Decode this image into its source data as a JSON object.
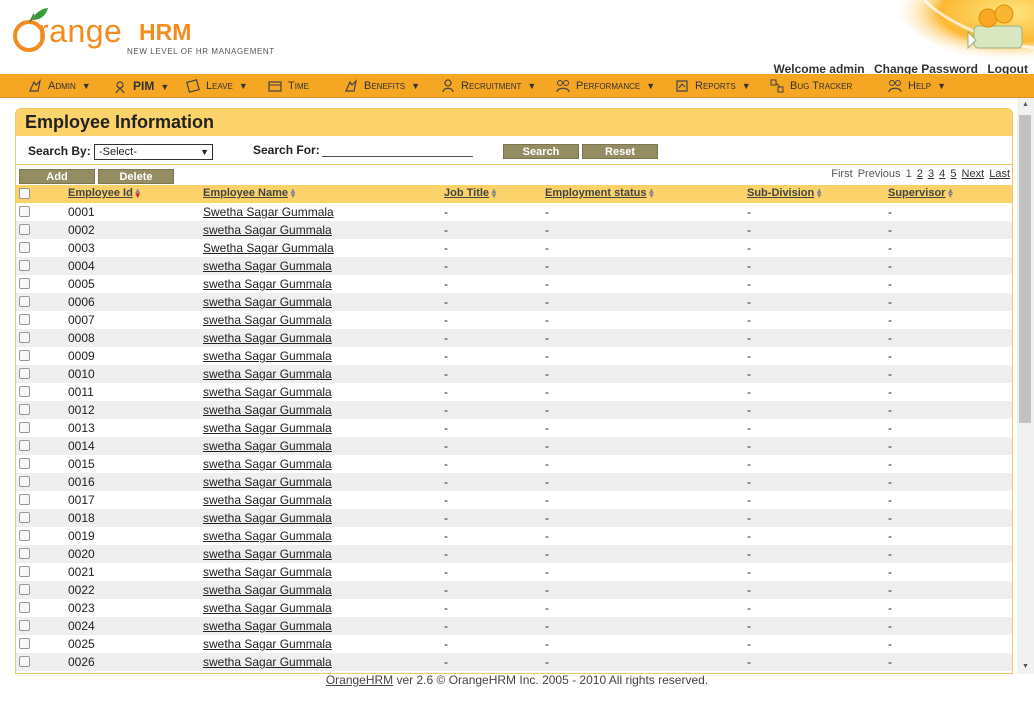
{
  "brand": {
    "logo_main": "range",
    "logo_suffix": "HRM",
    "tagline": "NEW LEVEL OF HR MANAGEMENT",
    "accent": "#f5a623",
    "header_bar": "#fbd36a",
    "button_color": "#948d63"
  },
  "user": {
    "welcome": "Welcome admin",
    "change_password": "Change Password",
    "logout": "Logout"
  },
  "menu": [
    {
      "label": "Admin",
      "icon": "admin-icon"
    },
    {
      "label": "PIM",
      "icon": "pim-icon",
      "active": true
    },
    {
      "label": "Leave",
      "icon": "leave-icon"
    },
    {
      "label": "Time",
      "icon": "time-icon"
    },
    {
      "label": "Benefits",
      "icon": "benefits-icon"
    },
    {
      "label": "Recruitment",
      "icon": "recruitment-icon"
    },
    {
      "label": "Performance",
      "icon": "performance-icon"
    },
    {
      "label": "Reports",
      "icon": "reports-icon"
    },
    {
      "label": "Bug Tracker",
      "icon": "bug-tracker-icon"
    },
    {
      "label": "Help",
      "icon": "help-icon"
    }
  ],
  "page": {
    "title": "Employee Information",
    "search_by_label": "Search By:",
    "search_by_value": "-Select-",
    "search_for_label": "Search For:",
    "search_for_value": "",
    "search_button": "Search",
    "reset_button": "Reset",
    "add_button": "Add",
    "delete_button": "Delete"
  },
  "pager": {
    "first": "First",
    "previous": "Previous",
    "current": "1",
    "pages": [
      "2",
      "3",
      "4",
      "5"
    ],
    "next": "Next",
    "last": "Last"
  },
  "table": {
    "columns": [
      "Employee Id",
      "Employee Name",
      "Job Title",
      "Employment status",
      "Sub-Division",
      "Supervisor"
    ],
    "rows": [
      {
        "id": "0001",
        "name": "Swetha Sagar Gummala",
        "job": "-",
        "status": "-",
        "sub": "-",
        "sup": "-"
      },
      {
        "id": "0002",
        "name": "swetha Sagar Gummala",
        "job": "-",
        "status": "-",
        "sub": "-",
        "sup": "-"
      },
      {
        "id": "0003",
        "name": "Swetha Sagar Gummala",
        "job": "-",
        "status": "-",
        "sub": "-",
        "sup": "-"
      },
      {
        "id": "0004",
        "name": "swetha Sagar Gummala",
        "job": "-",
        "status": "-",
        "sub": "-",
        "sup": "-"
      },
      {
        "id": "0005",
        "name": "swetha Sagar Gummala",
        "job": "-",
        "status": "-",
        "sub": "-",
        "sup": "-"
      },
      {
        "id": "0006",
        "name": "swetha Sagar Gummala",
        "job": "-",
        "status": "-",
        "sub": "-",
        "sup": "-"
      },
      {
        "id": "0007",
        "name": "swetha Sagar Gummala",
        "job": "-",
        "status": "-",
        "sub": "-",
        "sup": "-"
      },
      {
        "id": "0008",
        "name": "swetha Sagar Gummala",
        "job": "-",
        "status": "-",
        "sub": "-",
        "sup": "-"
      },
      {
        "id": "0009",
        "name": "swetha Sagar Gummala",
        "job": "-",
        "status": "-",
        "sub": "-",
        "sup": "-"
      },
      {
        "id": "0010",
        "name": "swetha Sagar Gummala",
        "job": "-",
        "status": "-",
        "sub": "-",
        "sup": "-"
      },
      {
        "id": "0011",
        "name": "swetha Sagar Gummala",
        "job": "-",
        "status": "-",
        "sub": "-",
        "sup": "-"
      },
      {
        "id": "0012",
        "name": "swetha Sagar Gummala",
        "job": "-",
        "status": "-",
        "sub": "-",
        "sup": "-"
      },
      {
        "id": "0013",
        "name": "swetha Sagar Gummala",
        "job": "-",
        "status": "-",
        "sub": "-",
        "sup": "-"
      },
      {
        "id": "0014",
        "name": "swetha Sagar Gummala",
        "job": "-",
        "status": "-",
        "sub": "-",
        "sup": "-"
      },
      {
        "id": "0015",
        "name": "swetha Sagar Gummala",
        "job": "-",
        "status": "-",
        "sub": "-",
        "sup": "-"
      },
      {
        "id": "0016",
        "name": "swetha Sagar Gummala",
        "job": "-",
        "status": "-",
        "sub": "-",
        "sup": "-"
      },
      {
        "id": "0017",
        "name": "swetha Sagar Gummala",
        "job": "-",
        "status": "-",
        "sub": "-",
        "sup": "-"
      },
      {
        "id": "0018",
        "name": "swetha Sagar Gummala",
        "job": "-",
        "status": "-",
        "sub": "-",
        "sup": "-"
      },
      {
        "id": "0019",
        "name": "swetha Sagar Gummala",
        "job": "-",
        "status": "-",
        "sub": "-",
        "sup": "-"
      },
      {
        "id": "0020",
        "name": "swetha Sagar Gummala",
        "job": "-",
        "status": "-",
        "sub": "-",
        "sup": "-"
      },
      {
        "id": "0021",
        "name": "swetha Sagar Gummala",
        "job": "-",
        "status": "-",
        "sub": "-",
        "sup": "-"
      },
      {
        "id": "0022",
        "name": "swetha Sagar Gummala",
        "job": "-",
        "status": "-",
        "sub": "-",
        "sup": "-"
      },
      {
        "id": "0023",
        "name": "swetha Sagar Gummala",
        "job": "-",
        "status": "-",
        "sub": "-",
        "sup": "-"
      },
      {
        "id": "0024",
        "name": "swetha Sagar Gummala",
        "job": "-",
        "status": "-",
        "sub": "-",
        "sup": "-"
      },
      {
        "id": "0025",
        "name": "swetha Sagar Gummala",
        "job": "-",
        "status": "-",
        "sub": "-",
        "sup": "-"
      },
      {
        "id": "0026",
        "name": "swetha Sagar Gummala",
        "job": "-",
        "status": "-",
        "sub": "-",
        "sup": "-"
      }
    ]
  },
  "footer": {
    "link": "OrangeHRM",
    "text": " ver 2.6 © OrangeHRM Inc. 2005 - 2010 All rights reserved."
  }
}
